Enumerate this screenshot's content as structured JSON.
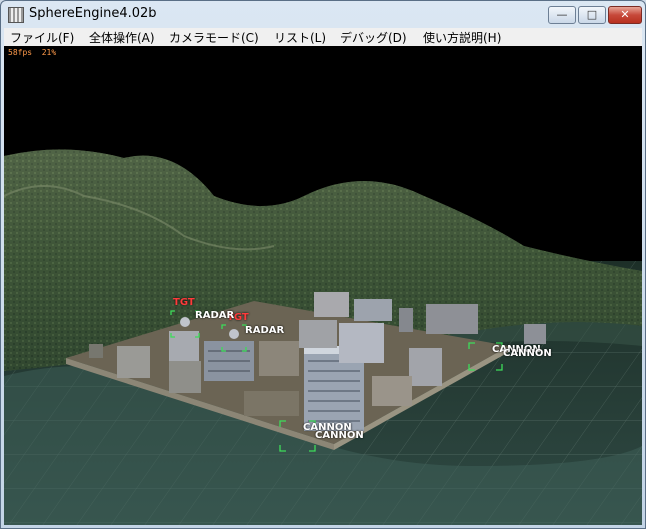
{
  "window": {
    "title": "SphereEngine4.02b"
  },
  "window_controls": {
    "minimize": "—",
    "maximize": "□",
    "close": "✕"
  },
  "menu": {
    "file": "ファイル(F)",
    "global_ops": "全体操作(A)",
    "camera_mode": "カメラモード(C)",
    "list": "リスト(L)",
    "debug": "デバッグ(D)",
    "help": "使い方説明(H)"
  },
  "hud": {
    "fps": "58fps",
    "load": "21%"
  },
  "scene": {
    "labels": {
      "tgt_1": "TGT",
      "tgt_2": "TGT",
      "radar_1": "RADAR",
      "radar_2": "RADAR",
      "cannon_1": "CANNON",
      "cannon_1b": "CANNON",
      "cannon_2": "CANNON",
      "cannon_2b": "CANNON"
    }
  },
  "colors": {
    "hud": "#ff9a4a",
    "target": "#ff3b3b",
    "bracket": "#3ddc5a",
    "label": "#ffffff"
  }
}
